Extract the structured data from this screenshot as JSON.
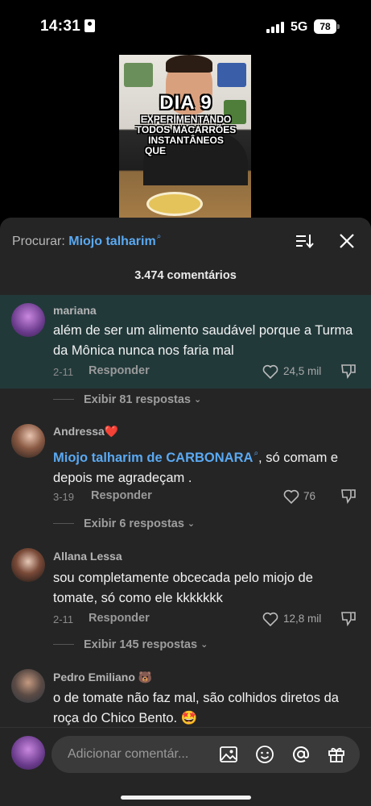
{
  "status_bar": {
    "time": "14:31",
    "network": "5G",
    "battery": "78"
  },
  "video": {
    "title_big": "DIA 9",
    "title_lines": [
      "EXPERIMENTANDO",
      "TODOS MACARRÕES",
      "INSTANTÂNEOS",
      "QUE"
    ]
  },
  "header": {
    "search_label": "Procurar:",
    "search_query": "Miojo talharim",
    "comment_count": "3.474 comentários"
  },
  "comments": [
    {
      "user": "mariana",
      "text": "além de ser um alimento saudável porque a Turma da Mônica nunca nos faria mal",
      "date": "2-11",
      "reply": "Responder",
      "likes": "24,5 mil",
      "more": "Exibir 81 respostas"
    },
    {
      "user": "Andressa❤️",
      "link": "Miojo talharim de CARBONARA",
      "text": ", só comam e depois me agradeçam .",
      "date": "3-19",
      "reply": "Responder",
      "likes": "76",
      "more": "Exibir 6 respostas"
    },
    {
      "user": "Allana Lessa",
      "text": "sou completamente obcecada pelo miojo de tomate, só como ele kkkkkkk",
      "date": "2-11",
      "reply": "Responder",
      "likes": "12,8 mil",
      "more": "Exibir 145 respostas"
    },
    {
      "user": "Pedro Emiliano 🐻",
      "text": "o de tomate não faz mal, são colhidos diretos da roça do Chico Bento. 🤩"
    }
  ],
  "composer": {
    "placeholder": "Adicionar comentár..."
  },
  "colors": {
    "accent": "#5aa9f2",
    "panel": "#252525",
    "highlight": "#22393a"
  },
  "icons": [
    "sort-icon",
    "close-icon",
    "heart-icon",
    "dislike-icon",
    "image-icon",
    "emoji-icon",
    "mention-icon",
    "gift-icon"
  ]
}
